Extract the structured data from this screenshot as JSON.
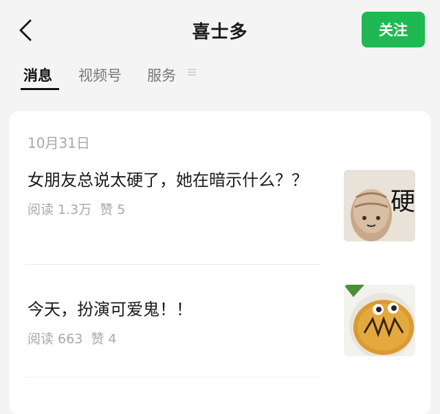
{
  "header": {
    "title": "喜士多",
    "follow_label": "关注",
    "back_icon": "chevron-left-icon"
  },
  "tabs": [
    {
      "label": "消息",
      "active": true
    },
    {
      "label": "视频号",
      "active": false
    },
    {
      "label": "服务",
      "active": false
    }
  ],
  "menu_icon": "menu-lines-icon",
  "feed": {
    "date": "10月31日",
    "articles": [
      {
        "title": "女朋友总说太硬了，她在暗示什么？？",
        "reads": "阅读 1.3万",
        "likes": "赞 5",
        "thumb_text": "硬"
      },
      {
        "title": "今天，扮演可爱鬼！！",
        "reads": "阅读 663",
        "likes": "赞 4"
      }
    ]
  },
  "colors": {
    "accent": "#1fb954",
    "background": "#f4f4f4",
    "card": "#ffffff",
    "muted_text": "#a8a8a8"
  }
}
